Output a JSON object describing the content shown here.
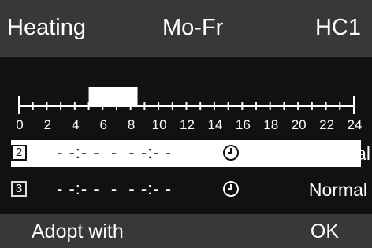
{
  "header": {
    "title": "Heating",
    "days": "Mo-Fr",
    "circuit": "HC1"
  },
  "timeline": {
    "labels": [
      "0",
      "2",
      "4",
      "6",
      "8",
      "10",
      "12",
      "14",
      "16",
      "18",
      "20",
      "22",
      "24"
    ],
    "heating_block": {
      "from_hour": 5,
      "to_hour": 8.5
    }
  },
  "rows": [
    {
      "index": "2",
      "times": "- -:- -  -  - -:- -",
      "clock_icon": "clock-icon",
      "mode": "Normal",
      "selected": true
    },
    {
      "index": "3",
      "times": "- -:- -  -  - -:- -",
      "clock_icon": "clock-icon",
      "mode": "Normal",
      "selected": false
    }
  ],
  "footer": {
    "left": "Adopt with",
    "right": "OK"
  }
}
